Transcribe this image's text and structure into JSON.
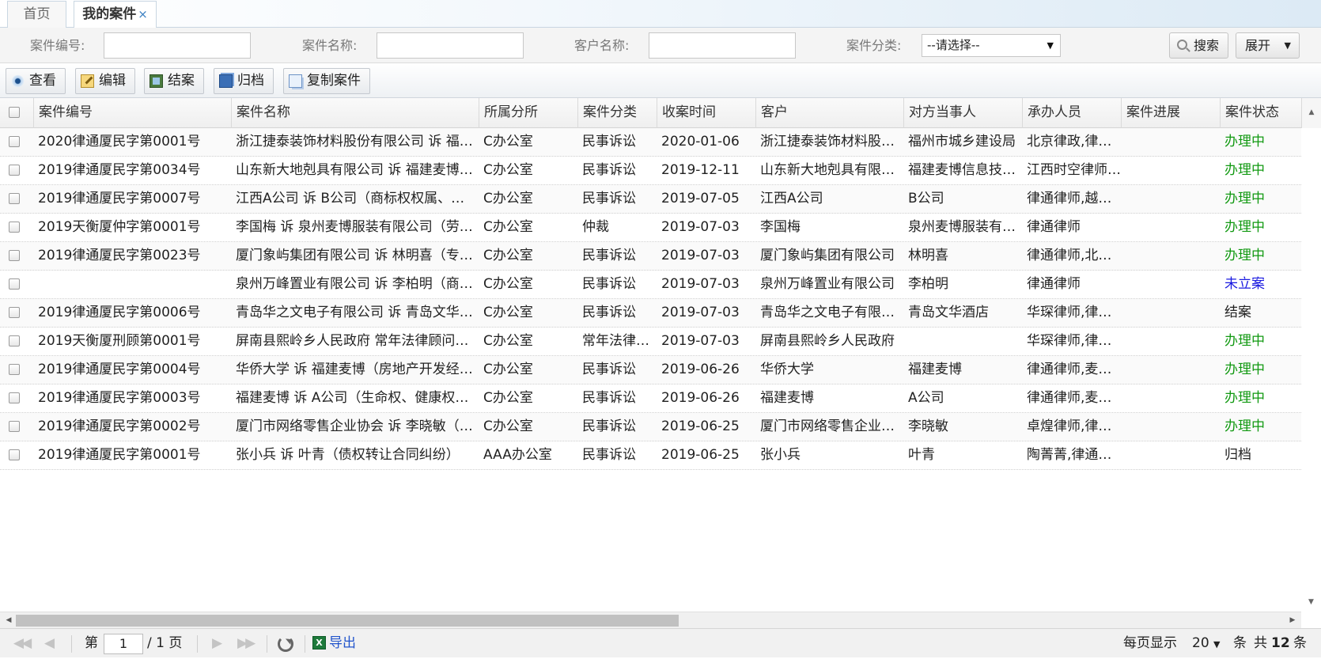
{
  "tabs": {
    "home": "首页",
    "active": "我的案件",
    "close_glyph": "×"
  },
  "search": {
    "case_no_label": "案件编号:",
    "case_name_label": "案件名称:",
    "client_label": "客户名称:",
    "category_label": "案件分类:",
    "category_selected": "--请选择--",
    "search_button": "搜索",
    "expand_button": "展开"
  },
  "toolbar": {
    "view": "查看",
    "edit": "编辑",
    "close_case": "结案",
    "archive": "归档",
    "copy_case": "复制案件"
  },
  "columns": [
    "案件编号",
    "案件名称",
    "所属分所",
    "案件分类",
    "收案时间",
    "客户",
    "对方当事人",
    "承办人员",
    "案件进展",
    "案件状态"
  ],
  "rows": [
    {
      "no": "2020律通厦民字第0001号",
      "name": "浙江捷泰装饰材料股份有限公司 诉 福…",
      "branch": "C办公室",
      "category": "民事诉讼",
      "date": "2020-01-06",
      "client": "浙江捷泰装饰材料股…",
      "opponent": "福州市城乡建设局",
      "handlers": "北京律政,律…",
      "progress": "",
      "status": "办理中",
      "status_type": "open"
    },
    {
      "no": "2019律通厦民字第0034号",
      "name": "山东新大地剋具有限公司 诉 福建麦博…",
      "branch": "C办公室",
      "category": "民事诉讼",
      "date": "2019-12-11",
      "client": "山东新大地剋具有限…",
      "opponent": "福建麦博信息技…",
      "handlers": "江西时空律师…",
      "progress": "",
      "status": "办理中",
      "status_type": "open"
    },
    {
      "no": "2019律通厦民字第0007号",
      "name": "江西A公司 诉 B公司（商标权权属、…",
      "branch": "C办公室",
      "category": "民事诉讼",
      "date": "2019-07-05",
      "client": "江西A公司",
      "opponent": "B公司",
      "handlers": "律通律师,越…",
      "progress": "",
      "status": "办理中",
      "status_type": "open"
    },
    {
      "no": "2019天衡厦仲字第0001号",
      "name": "李国梅 诉 泉州麦博服装有限公司（劳…",
      "branch": "C办公室",
      "category": "仲裁",
      "date": "2019-07-03",
      "client": "李国梅",
      "opponent": "泉州麦博服装有…",
      "handlers": "律通律师",
      "progress": "",
      "status": "办理中",
      "status_type": "open"
    },
    {
      "no": "2019律通厦民字第0023号",
      "name": "厦门象屿集团有限公司 诉 林明喜（专…",
      "branch": "C办公室",
      "category": "民事诉讼",
      "date": "2019-07-03",
      "client": "厦门象屿集团有限公司",
      "opponent": "林明喜",
      "handlers": "律通律师,北…",
      "progress": "",
      "status": "办理中",
      "status_type": "open"
    },
    {
      "no": "",
      "name": "泉州万峰置业有限公司 诉 李柏明（商…",
      "branch": "C办公室",
      "category": "民事诉讼",
      "date": "2019-07-03",
      "client": "泉州万峰置业有限公司",
      "opponent": "李柏明",
      "handlers": "律通律师",
      "progress": "",
      "status": "未立案",
      "status_type": "new"
    },
    {
      "no": "2019律通厦民字第0006号",
      "name": "青岛华之文电子有限公司 诉 青岛文华…",
      "branch": "C办公室",
      "category": "民事诉讼",
      "date": "2019-07-03",
      "client": "青岛华之文电子有限…",
      "opponent": "青岛文华酒店",
      "handlers": "华琛律师,律…",
      "progress": "",
      "status": "结案",
      "status_type": "plain"
    },
    {
      "no": "2019天衡厦刑顾第0001号",
      "name": "屏南县熙岭乡人民政府 常年法律顾问…",
      "branch": "C办公室",
      "category": "常年法律…",
      "date": "2019-07-03",
      "client": "屏南县熙岭乡人民政府",
      "opponent": "",
      "handlers": "华琛律师,律…",
      "progress": "",
      "status": "办理中",
      "status_type": "open"
    },
    {
      "no": "2019律通厦民字第0004号",
      "name": "华侨大学 诉 福建麦博（房地产开发经…",
      "branch": "C办公室",
      "category": "民事诉讼",
      "date": "2019-06-26",
      "client": "华侨大学",
      "opponent": "福建麦博",
      "handlers": "律通律师,麦…",
      "progress": "",
      "status": "办理中",
      "status_type": "open"
    },
    {
      "no": "2019律通厦民字第0003号",
      "name": "福建麦博 诉 A公司（生命权、健康权…",
      "branch": "C办公室",
      "category": "民事诉讼",
      "date": "2019-06-26",
      "client": "福建麦博",
      "opponent": "A公司",
      "handlers": "律通律师,麦…",
      "progress": "",
      "status": "办理中",
      "status_type": "open"
    },
    {
      "no": "2019律通厦民字第0002号",
      "name": "厦门市网络零售企业协会 诉 李晓敏（…",
      "branch": "C办公室",
      "category": "民事诉讼",
      "date": "2019-06-25",
      "client": "厦门市网络零售企业…",
      "opponent": "李晓敏",
      "handlers": "卓煌律师,律…",
      "progress": "",
      "status": "办理中",
      "status_type": "open"
    },
    {
      "no": "2019律通厦民字第0001号",
      "name": "张小兵 诉 叶青（债权转让合同纠纷）",
      "branch": "AAA办公室",
      "category": "民事诉讼",
      "date": "2019-06-25",
      "client": "张小兵",
      "opponent": "叶青",
      "handlers": "陶菁菁,律通…",
      "progress": "",
      "status": "归档",
      "status_type": "plain"
    }
  ],
  "pager": {
    "page_prefix": "第",
    "current_page": "1",
    "page_suffix": "/ 1 页",
    "export": "导出",
    "per_page_label": "每页显示",
    "per_page_value": "20",
    "per_page_unit": "条",
    "total_prefix": "共",
    "total_count": "12",
    "total_unit": "条"
  },
  "colors": {
    "status_open": "#119911",
    "status_new": "#1a1ae0",
    "link": "#2255cc"
  }
}
